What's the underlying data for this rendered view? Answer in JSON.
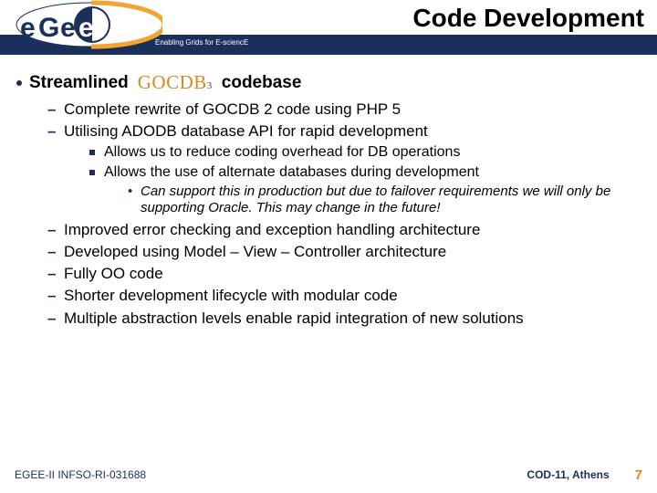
{
  "header": {
    "title": "Code Development",
    "tagline": "Enabling Grids for E-sciencE",
    "logo_text": "egee"
  },
  "main_bullet": {
    "before": "Streamlined",
    "logo": "GOCDB",
    "logo_sub": "3",
    "after": "codebase"
  },
  "l1": {
    "a": "Complete rewrite of GOCDB 2 code using PHP 5",
    "b": "Utilising ADODB database API for rapid development",
    "c": "Improved error checking and exception handling architecture",
    "d": "Developed using Model – View – Controller architecture",
    "e": "Fully OO code",
    "f": "Shorter development lifecycle with modular code",
    "g": "Multiple abstraction levels enable rapid integration of new solutions"
  },
  "l2": {
    "a": "Allows us to reduce coding overhead for DB operations",
    "b": "Allows the use of alternate databases during development"
  },
  "l3": {
    "a": "Can support this in production but due to failover requirements we will only be supporting Oracle.  This may change in the future!"
  },
  "footer": {
    "left": "EGEE-II INFSO-RI-031688",
    "center": "COD-11, Athens",
    "page": "7"
  }
}
